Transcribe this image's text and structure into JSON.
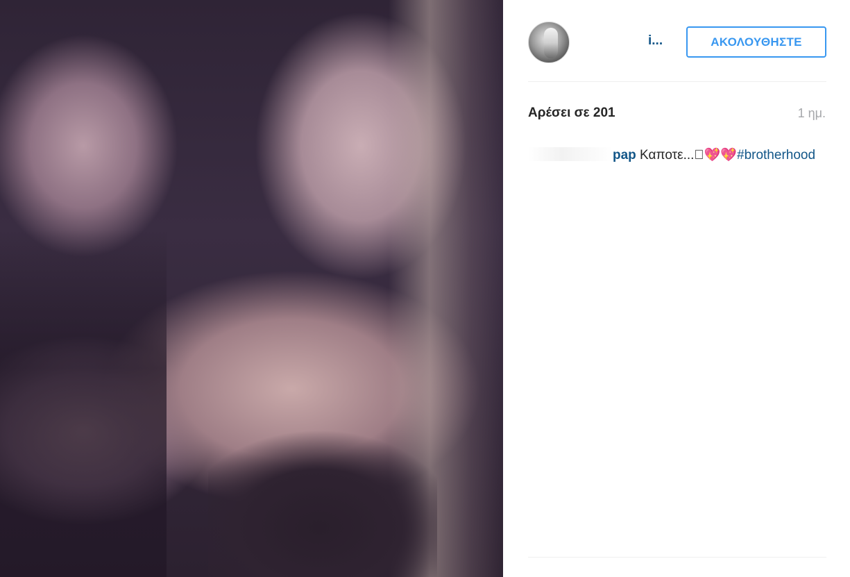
{
  "post": {
    "image_alt": "Two women taking a selfie",
    "header": {
      "username": "i...",
      "follow_label": "ΑΚΟΛΟΥΘΗΣΤΕ"
    },
    "likes_text": "Αρέσει σε 201",
    "time_ago": "1 ημ.",
    "caption": {
      "username_visible": "pap",
      "text": " Καποτε...􀀀💖💖",
      "hashtag": "#brotherhood"
    }
  },
  "colors": {
    "link_blue": "#125688",
    "button_blue": "#3897f0",
    "text": "#262626",
    "muted": "#a5a7aa"
  }
}
